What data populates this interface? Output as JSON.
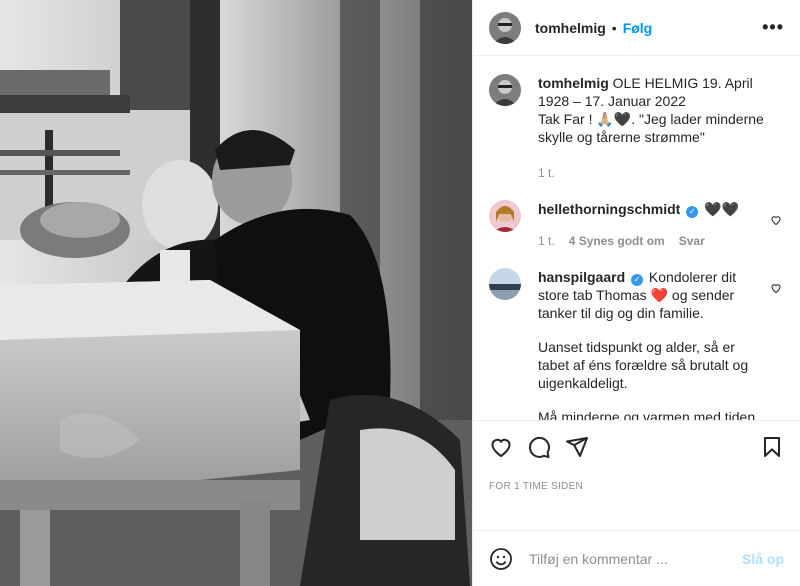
{
  "post": {
    "username": "tomhelmig",
    "follow_label": "Følg",
    "separator": "•",
    "more_label": "•••"
  },
  "caption": {
    "username": "tomhelmig",
    "text_line1": "OLE HELMIG 19. April 1928 – 17. Januar 2022",
    "text_line2": "Tak Far ! 🙏🏼🖤. \"Jeg lader minderne skylle og tårerne strømme\"",
    "time": "1 t."
  },
  "comments": [
    {
      "username": "hellethorningschmidt",
      "text": "🖤🖤",
      "time": "1 t.",
      "likes": "4 Synes godt om",
      "reply_label": "Svar"
    },
    {
      "username": "hanspilgaard",
      "text_a": "Kondolerer dit store tab Thomas",
      "text_b": "og sender tanker til dig og din familie.",
      "para2": "Uanset tidspunkt og alder, så er tabet af éns forældre så brutalt og uigenkaldeligt.",
      "para3": "Må minderne og varmen med tiden overskygge savnet og sorgen."
    }
  ],
  "footer": {
    "time_ago": "FOR 1 TIME SIDEN",
    "comment_placeholder": "Tilføj en kommentar ...",
    "post_label": "Slå op"
  },
  "colors": {
    "accent": "#0095f6",
    "post_disabled": "#b2dffc",
    "verified": "#3897f0"
  }
}
